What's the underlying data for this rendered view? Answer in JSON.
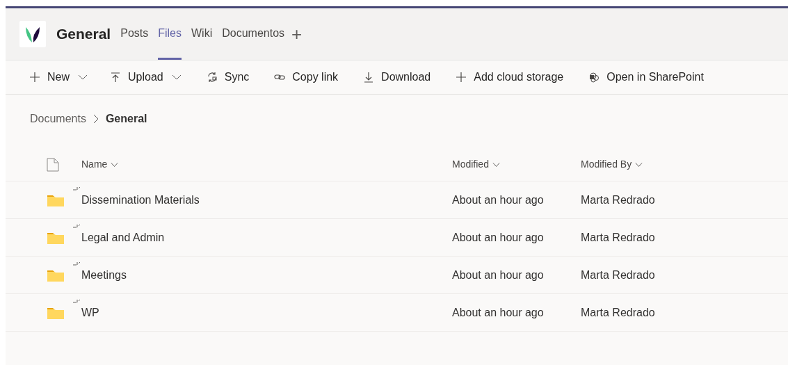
{
  "channel": {
    "title": "General",
    "tabs": [
      {
        "label": "Posts",
        "selected": false
      },
      {
        "label": "Files",
        "selected": true
      },
      {
        "label": "Wiki",
        "selected": false
      },
      {
        "label": "Documentos",
        "selected": false
      }
    ],
    "add_tab": "+"
  },
  "toolbar": [
    {
      "kind": "new",
      "label": "New",
      "dropdown": true
    },
    {
      "kind": "upload",
      "label": "Upload",
      "dropdown": true
    },
    {
      "kind": "sync",
      "label": "Sync",
      "dropdown": false
    },
    {
      "kind": "link",
      "label": "Copy link",
      "dropdown": false
    },
    {
      "kind": "download",
      "label": "Download",
      "dropdown": false
    },
    {
      "kind": "add",
      "label": "Add cloud storage",
      "dropdown": false
    },
    {
      "kind": "sharepoint",
      "label": "Open in SharePoint",
      "dropdown": false
    }
  ],
  "breadcrumb": [
    "Documents",
    "General"
  ],
  "table": {
    "columns": [
      "Name",
      "Modified",
      "Modified By"
    ],
    "rows": [
      {
        "name": "Dissemination Materials",
        "modified": "About an hour ago",
        "modified_by": "Marta Redrado"
      },
      {
        "name": "Legal and Admin",
        "modified": "About an hour ago",
        "modified_by": "Marta Redrado"
      },
      {
        "name": "Meetings",
        "modified": "About an hour ago",
        "modified_by": "Marta Redrado"
      },
      {
        "name": "WP",
        "modified": "About an hour ago",
        "modified_by": "Marta Redrado"
      }
    ]
  }
}
